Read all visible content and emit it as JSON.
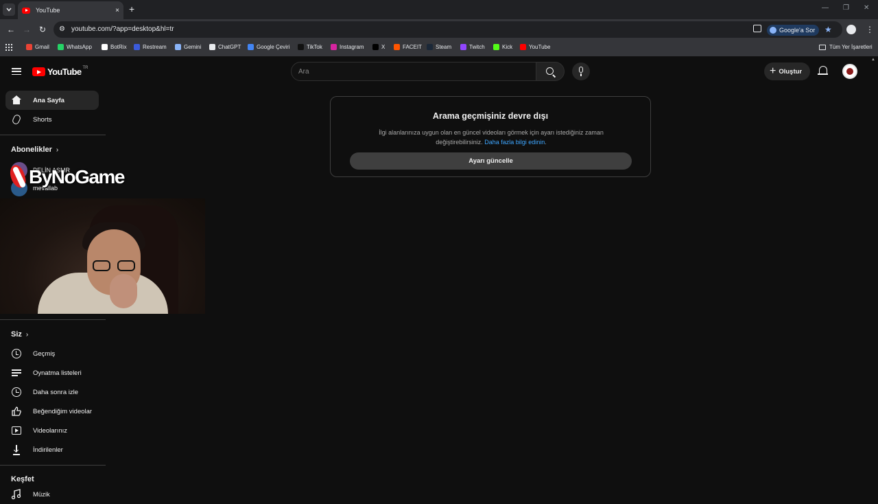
{
  "browser": {
    "tab_title": "YouTube",
    "tab_close": "×",
    "new_tab": "+",
    "url": "youtube.com/?app=desktop&hl=tr",
    "google_sor": "Google'a Sor",
    "controls": {
      "minimize": "—",
      "restore": "❐",
      "close": "✕"
    },
    "nav": {
      "back": "←",
      "forward": "→",
      "reload": "↻"
    },
    "bookmarks": [
      {
        "label": "Gmail",
        "color": "#ea4335"
      },
      {
        "label": "WhatsApp",
        "color": "#25d366"
      },
      {
        "label": "BotRix",
        "color": "#ffffff"
      },
      {
        "label": "Restream",
        "color": "#3b5bdb"
      },
      {
        "label": "Gemini",
        "color": "#8ab4f8"
      },
      {
        "label": "ChatGPT",
        "color": "#e8eaed"
      },
      {
        "label": "Google Çeviri",
        "color": "#4285f4"
      },
      {
        "label": "TikTok",
        "color": "#111111"
      },
      {
        "label": "Instagram",
        "color": "#d6249f"
      },
      {
        "label": "X",
        "color": "#000000"
      },
      {
        "label": "FACEIT",
        "color": "#ff5500"
      },
      {
        "label": "Steam",
        "color": "#1b2838"
      },
      {
        "label": "Twitch",
        "color": "#9146ff"
      },
      {
        "label": "Kick",
        "color": "#53fc18"
      },
      {
        "label": "YouTube",
        "color": "#ff0000"
      }
    ],
    "all_bookmarks": "Tüm Yer İşaretleri"
  },
  "header": {
    "logo_text": "YouTube",
    "country_code": "TR",
    "search_placeholder": "Ara",
    "create_label": "Oluştur"
  },
  "sidebar": {
    "main": [
      {
        "label": "Ana Sayfa",
        "icon": "home-icon"
      },
      {
        "label": "Shorts",
        "icon": "shorts-icon"
      }
    ],
    "subscriptions_title": "Abonelikler",
    "subscriptions": [
      {
        "name": "PELİN ASMR"
      },
      {
        "name": "mevallab"
      }
    ],
    "you_title": "Siz",
    "you_items": [
      {
        "label": "Geçmiş",
        "icon": "history-icon"
      },
      {
        "label": "Oynatma listeleri",
        "icon": "playlist-icon"
      },
      {
        "label": "Daha sonra izle",
        "icon": "clock-icon"
      },
      {
        "label": "Beğendiğim videolar",
        "icon": "thumbs-up-icon"
      },
      {
        "label": "Videolarınız",
        "icon": "your-videos-icon"
      },
      {
        "label": "İndirilenler",
        "icon": "download-icon"
      }
    ],
    "explore_title": "Keşfet",
    "explore_partial": "Müzik"
  },
  "overlay": {
    "brand": "ByNoGame"
  },
  "notice": {
    "title": "Arama geçmişiniz devre dışı",
    "body": "İlgi alanlarınıza uygun olan en güncel videoları görmek için ayarı istediğiniz zaman değiştirebilirsiniz.",
    "link": "Daha fazla bilgi edinin",
    "link_suffix": ".",
    "button": "Ayarı güncelle"
  }
}
